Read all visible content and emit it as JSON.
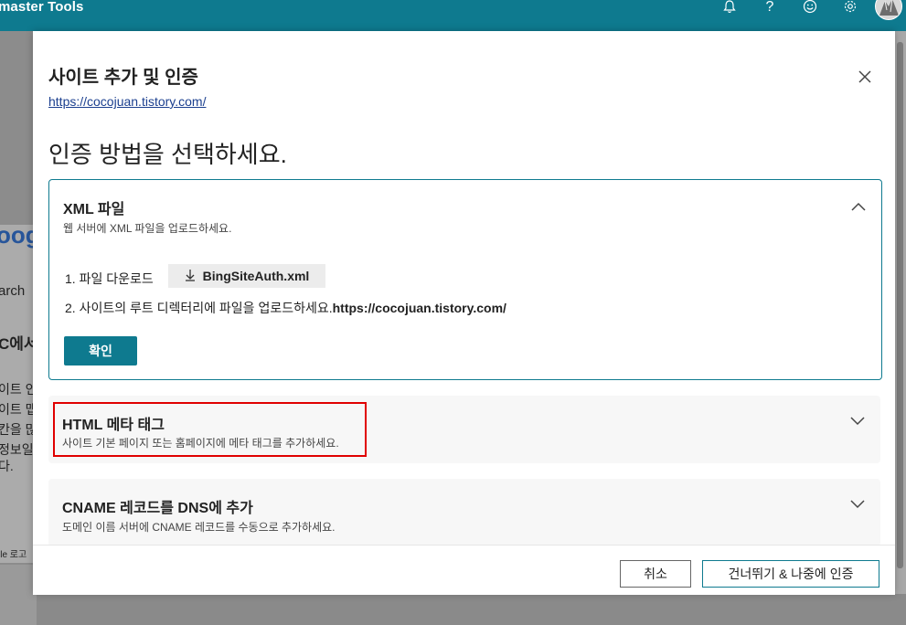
{
  "app": {
    "title": "master Tools"
  },
  "background": {
    "google_fragment": "oogl",
    "search_fragment": "arch",
    "heading_fragment": "C에서",
    "lines": [
      "이트 인",
      "이트 맵",
      "칸을 많",
      "정보일",
      "다."
    ],
    "footer_fragment": "ile 로고"
  },
  "dialog": {
    "title": "사이트 추가 및 인증",
    "url": "https://cocojuan.tistory.com/",
    "heading": "인증 방법을 선택하세요.",
    "methods": [
      {
        "title": "XML 파일",
        "subtitle": "웹 서버에 XML 파일을 업로드하세요.",
        "state": "expanded",
        "step1_label": "1. 파일 다운로드",
        "download_file": "BingSiteAuth.xml",
        "step2_label": "2. 사이트의 루트 디렉터리에 파일을 업로드하세요.",
        "step2_url": "https://cocojuan.tistory.com/",
        "confirm_label": "확인"
      },
      {
        "title": "HTML 메타 태그",
        "subtitle": "사이트 기본 페이지 또는 홈페이지에 메타 태그를 추가하세요.",
        "state": "collapsed"
      },
      {
        "title": "CNAME 레코드를 DNS에 추가",
        "subtitle": "도메인 이름 서버에 CNAME 레코드를 수동으로 추가하세요.",
        "state": "collapsed"
      }
    ],
    "footer": {
      "cancel_label": "취소",
      "skip_label": "건너뛰기 & 나중에 인증"
    }
  },
  "icons": [
    "bell-icon",
    "help-icon",
    "smiley-icon",
    "gear-icon",
    "avatar",
    "close-icon",
    "chevron-up-icon",
    "chevron-down-icon",
    "download-icon"
  ],
  "colors": {
    "accent": "#0e7a8f",
    "highlight": "#e00000",
    "url": "#1b3f8f"
  }
}
